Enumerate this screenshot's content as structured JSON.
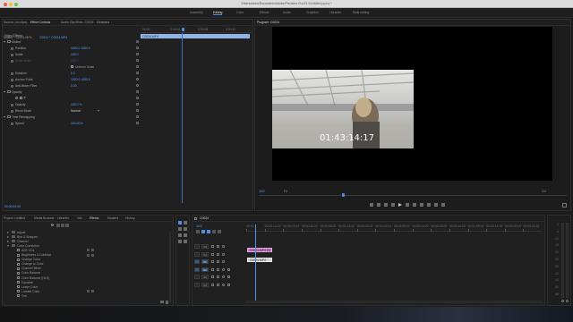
{
  "window_title": "/Users/adam/Documents/Adobe/Premiere Pro/13.0/Untitled.prproj *",
  "workspaces": [
    "Assembly",
    "Editing",
    "Color",
    "Effects",
    "Audio",
    "Graphics",
    "Libraries",
    "Multi-editing"
  ],
  "source_panel": {
    "tabs": [
      "Source: (no clips)",
      "Effect Controls",
      "Audio Clip Mixer: C0024",
      "Metadata"
    ],
    "breadcrumb_master": "Master * C0024.MP4",
    "breadcrumb_seq": "C0024 * C0024.MP4",
    "timecode_ticks": [
      "00:00",
      "0:00:04",
      "0:00:08",
      "0:00:12"
    ],
    "clip_bar_label": "C0024.MP4",
    "section_video": "Video Effects",
    "rows": [
      {
        "label": "Motion",
        "value": "",
        "indent": 1,
        "toggle": true,
        "fx": true
      },
      {
        "label": "Position",
        "value": "1920.0    1080.0",
        "indent": 2,
        "toggle": false,
        "fx": false
      },
      {
        "label": "Scale",
        "value": "100.0",
        "indent": 2,
        "toggle": false,
        "fx": false
      },
      {
        "label": "Scale Width",
        "value": "100.0",
        "indent": 2,
        "toggle": false,
        "fx": false,
        "dim": true
      },
      {
        "label": "",
        "value": "Uniform Scale",
        "indent": 2,
        "checkbox": true
      },
      {
        "label": "Rotation",
        "value": "0.0",
        "indent": 2,
        "toggle": false,
        "fx": false
      },
      {
        "label": "Anchor Point",
        "value": "1920.0    1080.0",
        "indent": 2,
        "toggle": false,
        "fx": false
      },
      {
        "label": "Anti-flicker Filter",
        "value": "0.00",
        "indent": 2,
        "toggle": false,
        "fx": false
      },
      {
        "label": "Opacity",
        "value": "",
        "indent": 1,
        "toggle": true,
        "fx": true
      },
      {
        "label": "",
        "value": "",
        "indent": 2,
        "shapes": true
      },
      {
        "label": "Opacity",
        "value": "100.0 %",
        "indent": 2,
        "toggle": false,
        "fx": false
      },
      {
        "label": "Blend Mode",
        "value": "Normal",
        "indent": 2,
        "toggle": false,
        "fx": false,
        "dropdown": true
      },
      {
        "label": "Time Remapping",
        "value": "",
        "indent": 1,
        "toggle": true,
        "fx": true
      },
      {
        "label": "Speed",
        "value": "100.00%",
        "indent": 2,
        "toggle": false,
        "fx": false
      }
    ],
    "footer_timecode": "00:00:00:00"
  },
  "program_panel": {
    "title": "Program: C0024",
    "overlay_timecode": "01:43:14:17",
    "current_timecode": "102",
    "fit_label": "Fit",
    "duration": "1/4",
    "playhead_fraction": 0.27
  },
  "project_panel": {
    "tabs": [
      "Project: Untitled",
      "Media Browser",
      "Libraries",
      "Info",
      "Effects",
      "Markers",
      "History"
    ],
    "search_placeholder": "",
    "items": [
      {
        "label": "Adjust",
        "indent": 1
      },
      {
        "label": "Blur & Sharpen",
        "indent": 1
      },
      {
        "label": "Channel",
        "indent": 1
      },
      {
        "label": "Color Correction",
        "indent": 1,
        "open": true
      },
      {
        "label": "ASC CDL",
        "indent": 2
      },
      {
        "label": "Brightness & Contrast",
        "indent": 2
      },
      {
        "label": "Change Color",
        "indent": 2
      },
      {
        "label": "Change to Color",
        "indent": 2
      },
      {
        "label": "Channel Mixer",
        "indent": 2
      },
      {
        "label": "Color Balance",
        "indent": 2
      },
      {
        "label": "Color Balance (HLS)",
        "indent": 2
      },
      {
        "label": "Equalize",
        "indent": 2
      },
      {
        "label": "Leave Color",
        "indent": 2
      },
      {
        "label": "Lumetri Color",
        "indent": 2
      },
      {
        "label": "Tint",
        "indent": 2
      }
    ]
  },
  "timeline_panel": {
    "title": "C0024",
    "timecode": "102",
    "ruler_ticks": [
      "00:00",
      "00:00:14:23",
      "00:00:29:23",
      "00:00:44:22",
      "00:00:59:22",
      "00:01:14:22",
      "00:01:29:21",
      "00:01:44:21",
      "00:01:59:21",
      "00:02:14:20",
      "00:02:29:20",
      "00:02:44:20",
      "00:02:59:19",
      "00:03:14:19",
      "00:03:29:19",
      "00:03:44:18"
    ],
    "tracks": [
      {
        "name": "V3",
        "active": false
      },
      {
        "name": "V2",
        "active": false
      },
      {
        "name": "V1",
        "active": true
      },
      {
        "name": "A1",
        "active": true
      },
      {
        "name": "A2",
        "active": false
      },
      {
        "name": "A3",
        "active": false
      }
    ],
    "clip_video_label": "C0024.MP4 [V]",
    "clip_audio_label": "C0024.MP4",
    "playhead_fraction": 0.03
  },
  "audio_meter_labels": [
    "0",
    "-6",
    "-12",
    "-18",
    "-24",
    "-30",
    "-36",
    "-42",
    "-48",
    "-54",
    "dB"
  ]
}
